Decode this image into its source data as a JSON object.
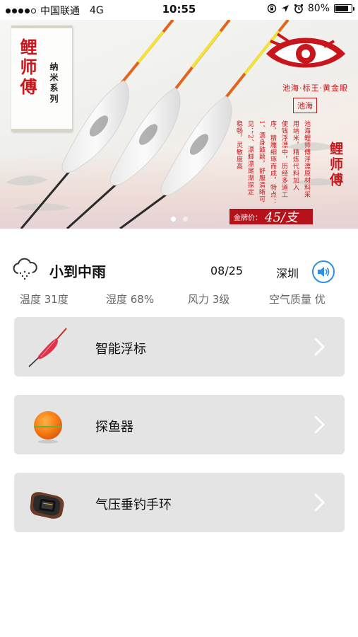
{
  "status_bar": {
    "carrier": "中国联通",
    "network": "4G",
    "time": "10:55",
    "battery_percent": "80%",
    "battery_level": 0.8
  },
  "banner": {
    "brand": "鲤师傅",
    "series": "纳米系列",
    "logo_text": "池海·标王·黄金眼",
    "stamp": "池海",
    "description_columns": [
      "池海鲤师傅浮漂原材料采",
      "用纳米，精炼代料加入",
      "使钱浮漂中，历经多道工",
      "序，精雕细琢而成，特点：",
      "1、漂身鼓颖，舒服清晰可",
      "见；2、漂脚漂尾渐探定",
      "稳畅，灵敏度高"
    ],
    "brand_repeat": "鲤师傅",
    "price_label": "金牌价：",
    "price_value": "45/支",
    "slides_total": 2,
    "active_slide": 0
  },
  "weather": {
    "condition": "小到中雨",
    "date": "08/25",
    "city": "深圳",
    "temperature": "温度 31度",
    "humidity": "湿度 68%",
    "wind": "风力 3级",
    "air_quality": "空气质量 优"
  },
  "menu": [
    {
      "label": "智能浮标",
      "icon": "float-icon"
    },
    {
      "label": "探鱼器",
      "icon": "fish-finder-icon"
    },
    {
      "label": "气压垂钓手环",
      "icon": "wristband-icon"
    }
  ],
  "colors": {
    "brand_red": "#c8161d",
    "accent_blue": "#2f8fe6",
    "card_bg": "#e4e4e4"
  }
}
